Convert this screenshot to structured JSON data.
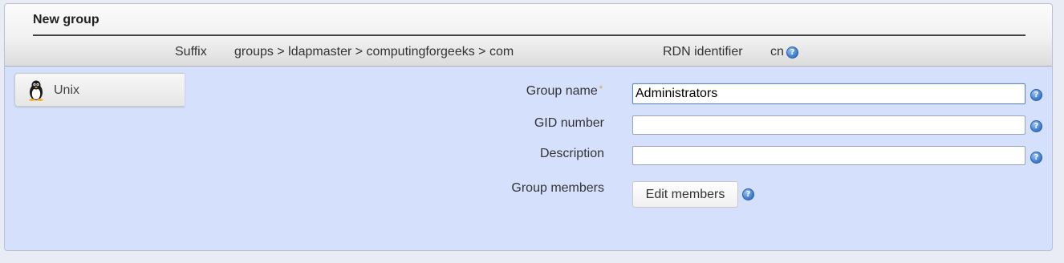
{
  "panel": {
    "title": "New group"
  },
  "header": {
    "suffix_label": "Suffix",
    "suffix_value": "groups > ldapmaster > computingforgeeks > com",
    "rdn_label": "RDN identifier",
    "rdn_value": "cn"
  },
  "tabs": [
    {
      "label": "Unix",
      "icon": "tux-penguin-icon"
    }
  ],
  "form": {
    "group_name": {
      "label": "Group name",
      "required_mark": "*",
      "value": "Administrators"
    },
    "gid_number": {
      "label": "GID number",
      "value": ""
    },
    "description": {
      "label": "Description",
      "value": ""
    },
    "group_members": {
      "label": "Group members",
      "button_label": "Edit members"
    }
  },
  "help_glyph": "?",
  "colors": {
    "panel_background": "#d4e0fc",
    "help_icon": "#4a86d8",
    "required_star": "#e0a020"
  }
}
